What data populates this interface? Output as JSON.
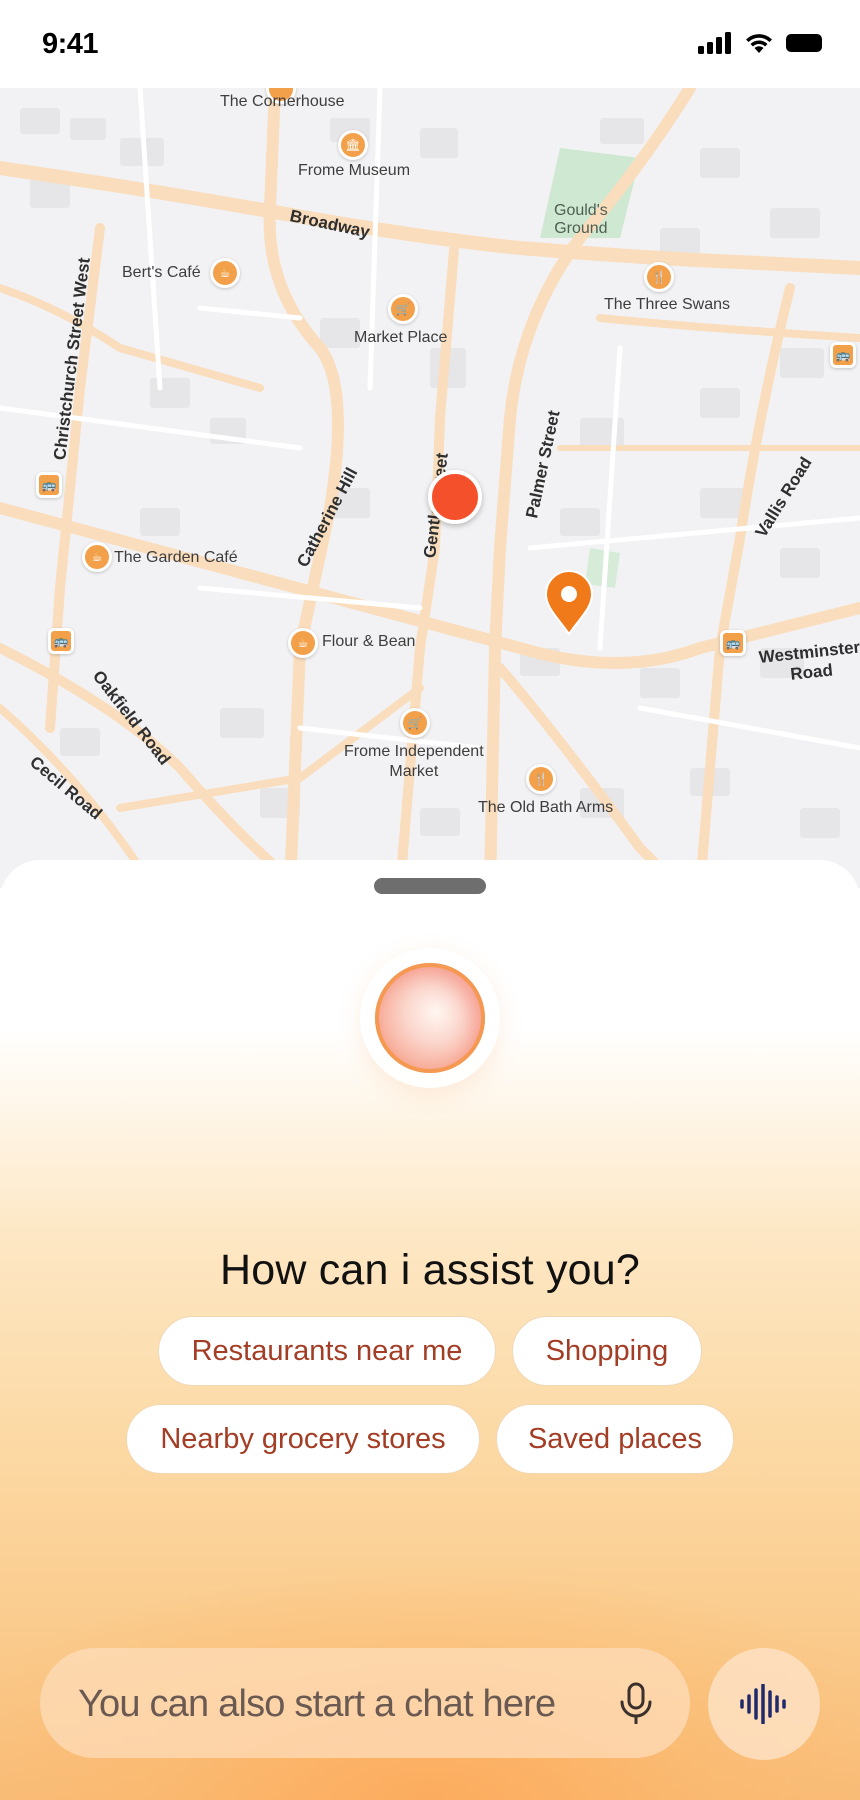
{
  "status_bar": {
    "time": "9:41"
  },
  "map": {
    "streets": {
      "broadway": "Broadway",
      "christchurch": "Christchurch Street West",
      "catherine_hill": "Catherine Hill",
      "gentle_street": "Gentle Street",
      "palmer_street": "Palmer Street",
      "vallis_road": "Vallis Road",
      "oakfield_road": "Oakfield Road",
      "cecil_road": "Cecil Road",
      "westminster_road_1": "Westminster",
      "westminster_road_2": "Road"
    },
    "places": {
      "cornerhouse": "The Cornerhouse",
      "frome_museum": "Frome Museum",
      "goulds_ground_1": "Gould's",
      "goulds_ground_2": "Ground",
      "berts_cafe": "Bert's Café",
      "market_place": "Market Place",
      "three_swans": "The Three Swans",
      "garden_cafe": "The Garden Café",
      "flour_bean": "Flour & Bean",
      "frome_independent_1": "Frome Independent",
      "frome_independent_2": "Market",
      "old_bath_arms": "The Old Bath Arms"
    }
  },
  "assistant": {
    "headline": "How can i assist you?",
    "suggestions": [
      "Restaurants near me",
      "Shopping",
      "Nearby grocery stores",
      "Saved places"
    ],
    "chat_placeholder": "You can also start a chat here"
  },
  "colors": {
    "accent": "#f07a1a",
    "location_dot": "#f4502c",
    "chip_text": "#a43d25"
  },
  "icons": [
    "signal-icon",
    "wifi-icon",
    "battery-icon",
    "museum-icon",
    "cafe-icon",
    "cart-icon",
    "restaurant-icon",
    "bus-icon",
    "map-pin-icon",
    "mic-icon",
    "voice-wave-icon"
  ]
}
